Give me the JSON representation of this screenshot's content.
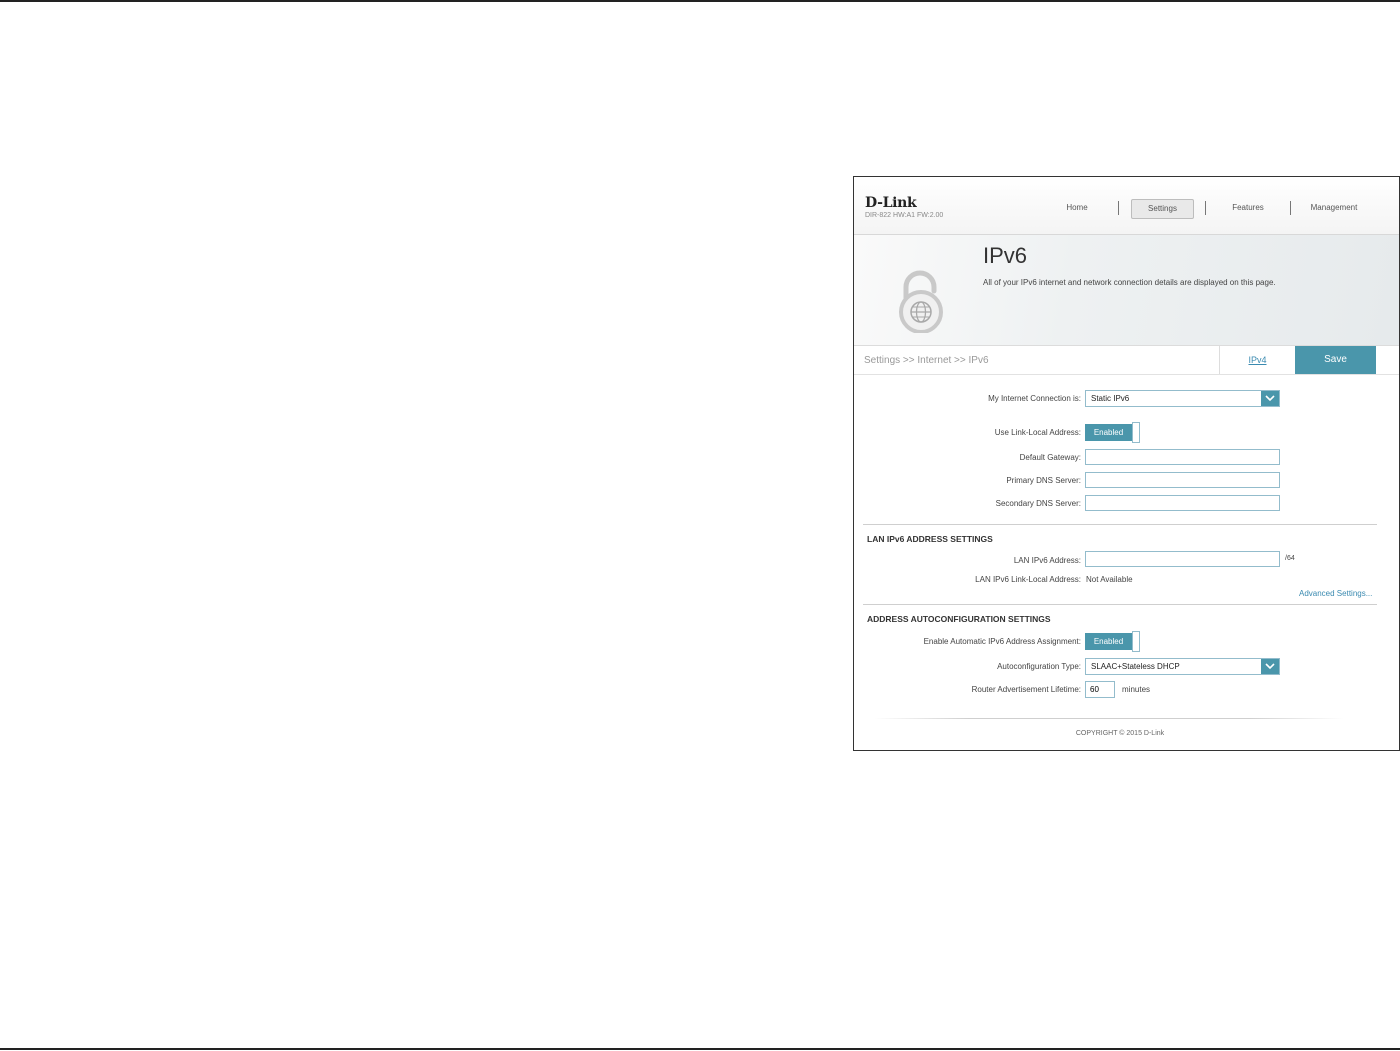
{
  "header": {
    "logo": "D-Link",
    "model": "DIR-822 HW:A1 FW:2.00",
    "nav": [
      {
        "label": "Home",
        "active": false
      },
      {
        "label": "Settings",
        "active": true
      },
      {
        "label": "Features",
        "active": false
      },
      {
        "label": "Management",
        "active": false
      }
    ]
  },
  "banner": {
    "icon": "ipv6-lock-globe-icon",
    "title": "IPv6",
    "description": "All of your IPv6 internet and network connection details are displayed on this page."
  },
  "breadcrumb": "Settings >> Internet >> IPv6",
  "ipv4_link": "IPv4",
  "save_label": "Save",
  "connection": {
    "label": "My Internet Connection is:",
    "value": "Static IPv6"
  },
  "link_local": {
    "label": "Use Link-Local Address:",
    "value": "Enabled"
  },
  "default_gateway": {
    "label": "Default Gateway:",
    "value": ""
  },
  "primary_dns": {
    "label": "Primary DNS Server:",
    "value": ""
  },
  "secondary_dns": {
    "label": "Secondary DNS Server:",
    "value": ""
  },
  "lan": {
    "title": "LAN IPv6 ADDRESS SETTINGS",
    "address_label": "LAN IPv6 Address:",
    "address_value": "",
    "prefix_suffix": "/64",
    "link_local_label": "LAN IPv6 Link-Local Address:",
    "link_local_value": "Not Available",
    "advanced_link": "Advanced Settings..."
  },
  "autoconfig": {
    "title": "ADDRESS AUTOCONFIGURATION SETTINGS",
    "enable_label": "Enable Automatic IPv6 Address Assignment:",
    "enable_value": "Enabled",
    "type_label": "Autoconfiguration Type:",
    "type_value": "SLAAC+Stateless DHCP",
    "lifetime_label": "Router Advertisement Lifetime:",
    "lifetime_value": "60",
    "lifetime_unit": "minutes"
  },
  "footer": {
    "copyright": "COPYRIGHT © 2015 D-Link"
  },
  "colors": {
    "accent": "#4a96ab",
    "link": "#3a8ab0"
  }
}
